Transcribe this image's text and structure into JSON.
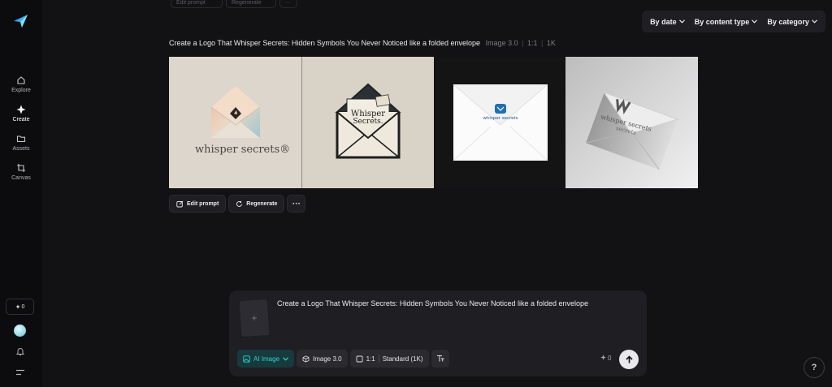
{
  "sidebar": {
    "items": [
      {
        "label": "Explore",
        "icon": "home-icon"
      },
      {
        "label": "Create",
        "icon": "sparkle-icon"
      },
      {
        "label": "Assets",
        "icon": "folder-icon"
      },
      {
        "label": "Canvas",
        "icon": "crop-icon"
      }
    ],
    "active": "Create",
    "credits": "0"
  },
  "ghost_actions": {
    "edit_label": "Edit prompt",
    "regenerate_label": "Regenerate",
    "more_label": "···"
  },
  "filters": {
    "by_date": "By date",
    "by_content_type": "By content type",
    "by_category": "By category"
  },
  "generation": {
    "prompt": "Create a Logo That Whisper Secrets: Hidden Symbols You Never Noticed like a folded envelope",
    "model": "Image 3.0",
    "ratio": "1:1",
    "resolution": "1K",
    "images": [
      {
        "brand_text": "whisper secrets®"
      },
      {
        "brand_text_line1": "Whisper",
        "brand_text_line2": "Secrets."
      },
      {
        "brand_text": "whisper secrets"
      },
      {
        "brand_text_line1": "whisper secrets",
        "brand_text_line2": "secrets"
      }
    ],
    "actions": {
      "edit_label": "Edit prompt",
      "regenerate_label": "Regenerate",
      "more_label": "···"
    }
  },
  "composer": {
    "prompt": "Create a Logo That Whisper Secrets: Hidden Symbols You Never Noticed like a folded envelope",
    "upload_symbol": "+",
    "mode_label": "AI Image",
    "model_label": "Image 3.0",
    "ratio_label": "1:1",
    "quality_label": "Standard (1K)",
    "cost": "0"
  },
  "help_label": "?",
  "colors": {
    "background": "#121214",
    "sidebar": "#0c0c0e",
    "panel": "#1f1f23",
    "accent": "#35d4cf"
  }
}
